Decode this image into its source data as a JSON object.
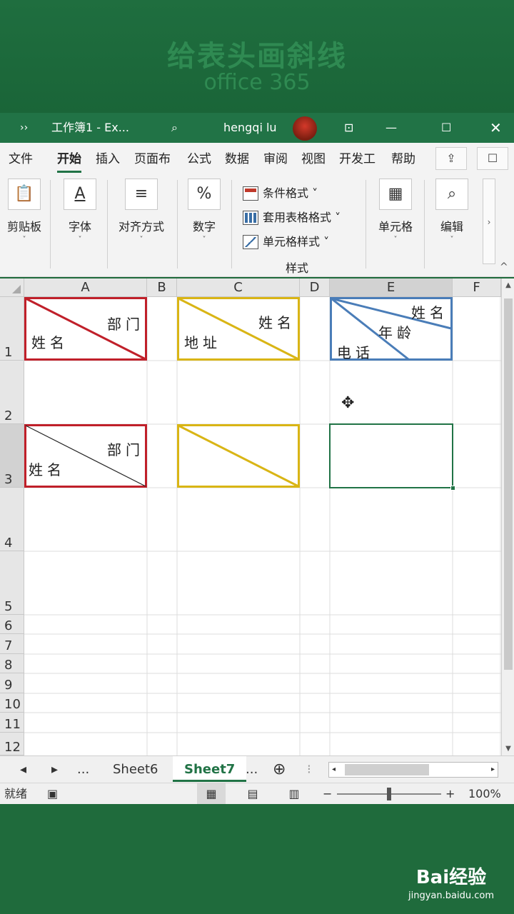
{
  "banner": {
    "title": "给表头画斜线",
    "subtitle": "office 365"
  },
  "titlebar": {
    "more": "››",
    "doc_title": "工作簿1  -  Ex...",
    "search_icon": "⌕",
    "user": "hengqi lu",
    "avatar_text": "头像",
    "ribbon_options_icon": "⊡",
    "minimize_icon": "—",
    "maximize_icon": "☐",
    "close_icon": "✕"
  },
  "menu": {
    "tabs": [
      "文件",
      "开始",
      "插入",
      "页面布",
      "公式",
      "数据",
      "审阅",
      "视图",
      "开发工",
      "帮助"
    ],
    "share_icon": "⇪",
    "comment_icon": "☐"
  },
  "ribbon": {
    "clipboard": {
      "label": "剪贴板",
      "icon": "📋"
    },
    "font": {
      "label": "字体",
      "icon": "A"
    },
    "align": {
      "label": "对齐方式",
      "icon": "≡"
    },
    "number": {
      "label": "数字",
      "icon": "%"
    },
    "styles": {
      "conditional": "条件格式 ˅",
      "table": "套用表格格式 ˅",
      "cell": "单元格样式 ˅",
      "caption": "样式"
    },
    "cells": {
      "label": "单元格",
      "icon": "▦"
    },
    "edit": {
      "label": "编辑",
      "icon": "⌕"
    },
    "caret": "˅",
    "scroll_icon": "›",
    "collapse_icon": "^"
  },
  "grid": {
    "columns": [
      "A",
      "B",
      "C",
      "D",
      "E",
      "F"
    ],
    "rows": [
      "1",
      "2",
      "3",
      "4",
      "5",
      "6",
      "7",
      "8",
      "9",
      "10",
      "11",
      "12"
    ],
    "selected_column": "E",
    "selected_row": "3",
    "headers": {
      "a1": {
        "top": "部门",
        "bottom": "姓名"
      },
      "c1": {
        "top": "姓名",
        "bottom": "地址"
      },
      "e1": {
        "top": "姓名",
        "middle": "年龄",
        "bottom": "电话"
      },
      "a3": {
        "top": "部门",
        "bottom": "姓名"
      }
    },
    "cursor_icon": "✥"
  },
  "sheets": {
    "prev_icon": "◂",
    "next_icon": "▸",
    "ellipsis": "...",
    "tabs": [
      "Sheet6",
      "Sheet7"
    ],
    "active": "Sheet7",
    "add_icon": "⊕",
    "splitter": "⁝"
  },
  "status": {
    "ready": "就绪",
    "macro_icon": "▣",
    "view_normal": "▦",
    "view_page": "▤",
    "view_break": "▥",
    "zoom_minus": "−",
    "zoom_plus": "+",
    "zoom": "100%"
  },
  "watermark": {
    "logo": "Bai经验",
    "url": "jingyan.baidu.com"
  },
  "colors": {
    "excel_green": "#217346",
    "red": "#c0202a",
    "yellow": "#d9b515",
    "blue": "#4a7db8"
  }
}
